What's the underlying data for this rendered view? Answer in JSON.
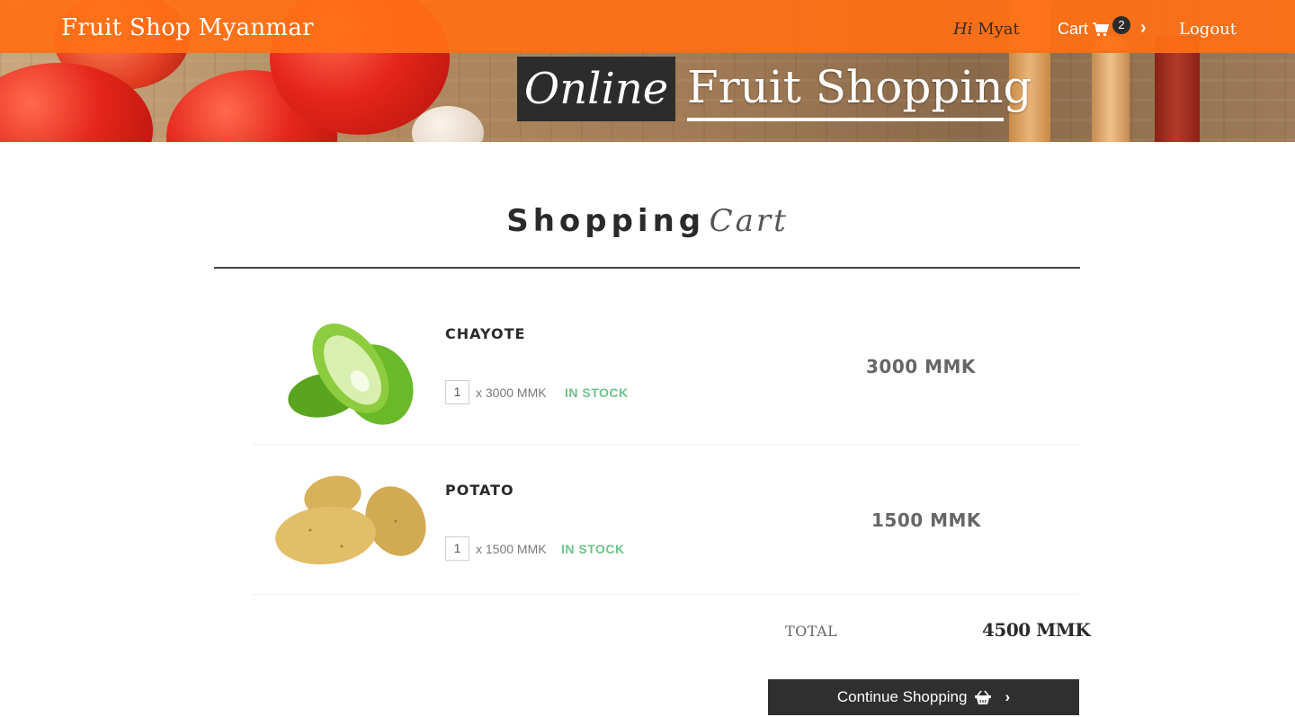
{
  "navbar": {
    "brand": "Fruit Shop Myanmar",
    "greeting_hi": "Hi",
    "greeting_name": "Myat",
    "cart_label": "Cart",
    "cart_count": "2",
    "logout_label": "Logout"
  },
  "hero": {
    "headline_online": "Online",
    "headline_fruit": "Fruit Shopping"
  },
  "cart": {
    "title_strong": "Shopping",
    "title_em": "Cart",
    "items": [
      {
        "name": "CHAYOTE",
        "qty": "1",
        "unit_price": "x 3000 MMK",
        "stock": "IN STOCK",
        "line_total": "3000 MMK",
        "image": "chayote-image"
      },
      {
        "name": "POTATO",
        "qty": "1",
        "unit_price": "x 1500 MMK",
        "stock": "IN STOCK",
        "line_total": "1500 MMK",
        "image": "potato-image"
      }
    ],
    "total_label": "TOTAL",
    "total_value": "4500 MMK",
    "continue_label": "Continue Shopping"
  },
  "colors": {
    "navbar": "#ff7014",
    "stock": "#6cc48a",
    "button": "#2f2f2f"
  }
}
